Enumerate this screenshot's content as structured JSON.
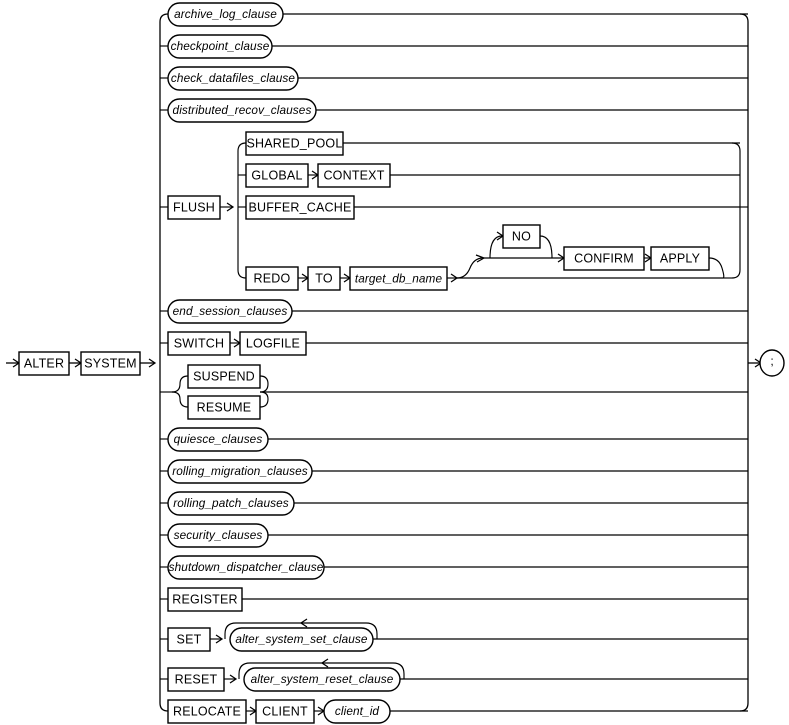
{
  "diagram": {
    "kind": "railroad-syntax-diagram",
    "title": "ALTER SYSTEM",
    "stroke_color": "#000000",
    "background_color": "#ffffff",
    "terminator_label": ";",
    "entry": {
      "alter_label": "ALTER",
      "system_label": "SYSTEM"
    },
    "branches": [
      {
        "id": "archive-log-clause",
        "label": "archive_log_clause",
        "shape": "stadium"
      },
      {
        "id": "checkpoint-clause",
        "label": "checkpoint_clause",
        "shape": "stadium"
      },
      {
        "id": "check-datafiles-clause",
        "label": "check_datafiles_clause",
        "shape": "stadium"
      },
      {
        "id": "distributed-recov-clauses",
        "label": "distributed_recov_clauses",
        "shape": "stadium"
      },
      {
        "id": "flush",
        "label": "FLUSH",
        "shape": "box"
      },
      {
        "id": "end-session-clauses",
        "label": "end_session_clauses",
        "shape": "stadium"
      },
      {
        "id": "switch",
        "label": "SWITCH",
        "shape": "box"
      },
      {
        "id": "suspend",
        "label": "SUSPEND",
        "shape": "box"
      },
      {
        "id": "resume",
        "label": "RESUME",
        "shape": "box"
      },
      {
        "id": "quiesce-clauses",
        "label": "quiesce_clauses",
        "shape": "stadium"
      },
      {
        "id": "rolling-migration-clauses",
        "label": "rolling_migration_clauses",
        "shape": "stadium"
      },
      {
        "id": "rolling-patch-clauses",
        "label": "rolling_patch_clauses",
        "shape": "stadium"
      },
      {
        "id": "security-clauses",
        "label": "security_clauses",
        "shape": "stadium"
      },
      {
        "id": "shutdown-dispatcher-clause",
        "label": "shutdown_dispatcher_clause",
        "shape": "stadium"
      },
      {
        "id": "register",
        "label": "REGISTER",
        "shape": "box"
      },
      {
        "id": "set",
        "label": "SET",
        "shape": "box"
      },
      {
        "id": "reset",
        "label": "RESET",
        "shape": "box"
      },
      {
        "id": "relocate",
        "label": "RELOCATE",
        "shape": "box"
      }
    ],
    "flush_options": [
      {
        "id": "shared-pool",
        "label": "SHARED_POOL",
        "shape": "box"
      },
      {
        "id": "global",
        "label": "GLOBAL",
        "shape": "box"
      },
      {
        "id": "context",
        "label": "CONTEXT",
        "shape": "box"
      },
      {
        "id": "buffer-cache",
        "label": "BUFFER_CACHE",
        "shape": "box"
      },
      {
        "id": "redo",
        "label": "REDO",
        "shape": "box"
      },
      {
        "id": "to",
        "label": "TO",
        "shape": "box"
      },
      {
        "id": "target-db-name",
        "label": "target_db_name",
        "shape": "box-italic"
      },
      {
        "id": "no",
        "label": "NO",
        "shape": "box"
      },
      {
        "id": "confirm",
        "label": "CONFIRM",
        "shape": "box"
      },
      {
        "id": "apply",
        "label": "APPLY",
        "shape": "box"
      }
    ],
    "switch_options": [
      {
        "id": "logfile",
        "label": "LOGFILE",
        "shape": "box"
      }
    ],
    "set_options": [
      {
        "id": "alter-system-set-clause",
        "label": "alter_system_set_clause",
        "shape": "stadium",
        "repeatable": true
      }
    ],
    "reset_options": [
      {
        "id": "alter-system-reset-clause",
        "label": "alter_system_reset_clause",
        "shape": "stadium",
        "repeatable": true
      }
    ],
    "relocate_options": [
      {
        "id": "client",
        "label": "CLIENT",
        "shape": "box"
      },
      {
        "id": "client-id",
        "label": "client_id",
        "shape": "stadium"
      }
    ]
  }
}
